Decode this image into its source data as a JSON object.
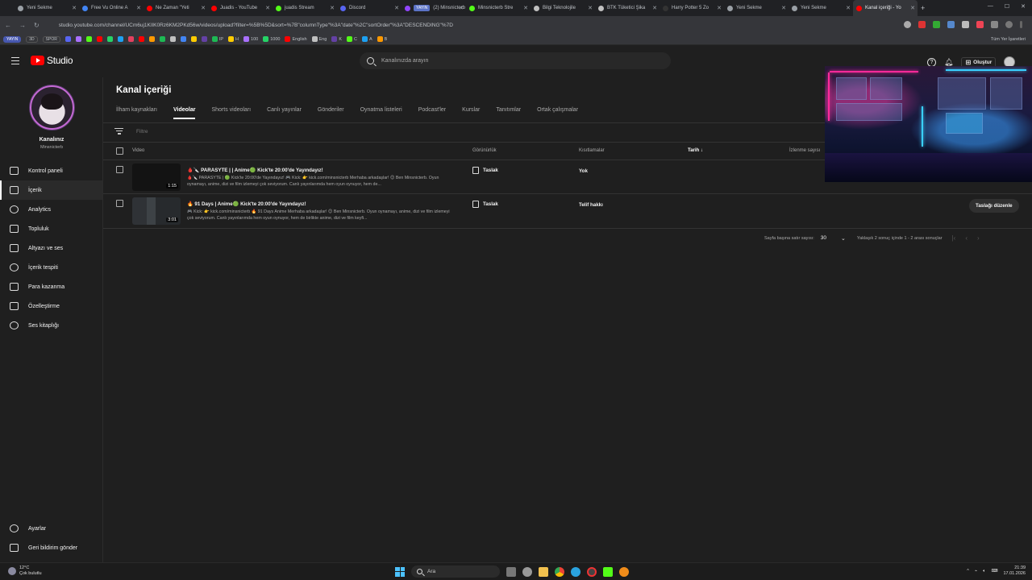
{
  "browser": {
    "tabs": [
      {
        "title": "Yeni Sekme",
        "color": "#9aa0a6"
      },
      {
        "title": "Free Vu Online A",
        "color": "#4285f4"
      },
      {
        "title": "Ne Zaman \"Yeti",
        "color": "#ff0000"
      },
      {
        "title": "Juadis - YouTube",
        "color": "#ff0000"
      },
      {
        "title": "juadis Stream",
        "color": "#53fc18"
      },
      {
        "title": "Discord",
        "color": "#5865f2"
      },
      {
        "title": "(2) Minsnicterb",
        "color": "#9146ff",
        "badge": "YAYIN"
      },
      {
        "title": "Minsnicterb Stre",
        "color": "#53fc18"
      },
      {
        "title": "Bilgi Teknolojile",
        "color": "#c0c0c0"
      },
      {
        "title": "BTK Tüketici Şika",
        "color": "#c0c0c0"
      },
      {
        "title": "Harry Potter 5 Zo",
        "color": "#333333"
      },
      {
        "title": "Yeni Sekme",
        "color": "#9aa0a6"
      },
      {
        "title": "Yeni Sekme",
        "color": "#9aa0a6"
      },
      {
        "title": "Kanal içeriği - Yo",
        "color": "#ff0000",
        "active": true
      }
    ],
    "url": "studio.youtube.com/channel/UCm6uj1KIlK0Rz6KM2PKd56w/videos/upload?filter=%5B%5D&sort=%7B\"columnType\"%3A\"date\"%2C\"sortOrder\"%3A\"DESCENDING\"%7D",
    "bookmarks": [
      "YAYIN",
      "3D",
      "SPOR",
      "IP",
      "H",
      "100",
      "1000",
      "English",
      "Eng",
      "K",
      "C",
      "A",
      "B"
    ],
    "bookmarks_right": "Tüm Yer İşaretleri"
  },
  "header": {
    "logo_text": "Studio",
    "search_placeholder": "Kanalınızda arayın",
    "create_label": "Oluştur"
  },
  "sidebar": {
    "channel_name": "Kanalınız",
    "channel_handle": "Minsnicterb",
    "items": [
      {
        "label": "Kontrol paneli",
        "icon": "dashboard-icon"
      },
      {
        "label": "İçerik",
        "icon": "content-icon",
        "selected": true
      },
      {
        "label": "Analytics",
        "icon": "analytics-icon"
      },
      {
        "label": "Topluluk",
        "icon": "community-icon"
      },
      {
        "label": "Altyazı ve ses",
        "icon": "subtitles-icon"
      },
      {
        "label": "İçerik tespiti",
        "icon": "copyright-icon"
      },
      {
        "label": "Para kazanma",
        "icon": "monetization-icon"
      },
      {
        "label": "Özelleştirme",
        "icon": "customization-icon"
      },
      {
        "label": "Ses kitaplığı",
        "icon": "audio-library-icon"
      }
    ],
    "bottom_items": [
      {
        "label": "Ayarlar",
        "icon": "settings-icon"
      },
      {
        "label": "Geri bildirim gönder",
        "icon": "feedback-icon"
      }
    ]
  },
  "main": {
    "title": "Kanal içeriği",
    "tabs": [
      "İlham kaynakları",
      "Videolar",
      "Shorts videoları",
      "Canlı yayınlar",
      "Gönderiler",
      "Oynatma listeleri",
      "Podcast'ler",
      "Kurslar",
      "Tanıtımlar",
      "Ortak çalışmalar"
    ],
    "active_tab": "Videolar",
    "filter_placeholder": "Filtre",
    "columns": {
      "video": "Video",
      "visibility": "Görünürlük",
      "restrictions": "Kısıtlamalar",
      "date": "Tarih",
      "views": "İzlenme sayısı"
    },
    "rows": [
      {
        "title": "🩸🔪 PARASYTE | | Anime🟢 Kick'te 20:00'de Yayındayız!",
        "description": "🩸🔪 PARASYTE | 🟢 Kick'te 20:00'de Yayındayız! 🎮 Kick: 👉 kick.com/minsnicterb Merhaba arkadaşlar! 😊 Ben Minsnicterb. Oyun oynamayı, anime, dizi ve film izlemeyi çok seviyorum. Canlı yayınlarımda hem oyun oynuyor, hem de...",
        "duration": "1:15",
        "visibility": "Taslak",
        "restrictions": "Yok",
        "action": ""
      },
      {
        "title": "🔥 91 Days | Anime🟢 Kick'te 20:00'de Yayındayız!",
        "description": "🎮 Kick: 👉 kick.com/minsnicterb 🔥 91 Days Anime Merhaba arkadaşlar! 😊 Ben Minsnicterb. Oyun oynamayı, anime, dizi ve film izlemeyi çok seviyorum. Canlı yayınlarımda hem oyun oynuyor, hem de birlikte anime, dizi ve film keyfi...",
        "duration": "3:01",
        "visibility": "Taslak",
        "restrictions": "Telif hakkı",
        "action": "Taslağı düzenle"
      }
    ],
    "pagination": {
      "rows_per_page_label": "Sayfa başına satır sayısı:",
      "rows_per_page": "30",
      "range_text": "Yaklaşık 2 sonuç içinde 1 - 2 arası sonuçlar"
    }
  },
  "taskbar": {
    "temperature": "12°C",
    "weather": "Çok bulutlu",
    "search_label": "Ara",
    "time": "21:39",
    "date": "17.01.2026"
  },
  "colors": {
    "background": "#1f1f1f",
    "accent_red": "#ff0000",
    "text_primary": "#f1f1f1",
    "text_secondary": "#aaaaaa"
  }
}
